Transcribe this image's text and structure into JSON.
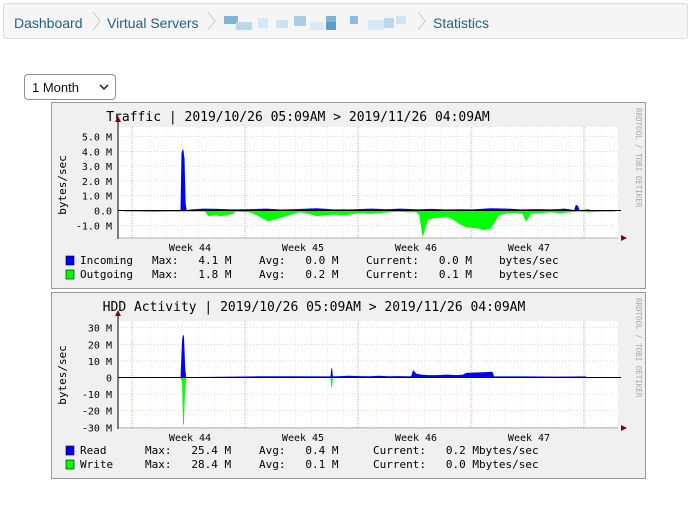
{
  "breadcrumb": {
    "dashboard": "Dashboard",
    "virtual_servers": "Virtual Servers",
    "statistics": "Statistics"
  },
  "period_select": {
    "value": "1 Month"
  },
  "graphs": {
    "traffic": {
      "title": "Traffic | 2019/10/26 05:09AM > 2019/11/26 04:09AM",
      "watermark": "RRDTOOL / TOBI OETIKER",
      "ylabel": "bytes/sec",
      "ticks": [
        "5.0 M",
        "4.0 M",
        "3.0 M",
        "2.0 M",
        "1.0 M",
        "0.0",
        "-1.0 M"
      ],
      "weeks": [
        "Week 44",
        "Week 45",
        "Week 46",
        "Week 47"
      ],
      "legend": [
        {
          "name": "Incoming",
          "color": "#0000ff",
          "max": "Max:   4.1 M",
          "avg": "Avg:   0.0 M",
          "current": "Current:   0.0 M",
          "unit": "bytes/sec"
        },
        {
          "name": "Outgoing",
          "color": "#00ff00",
          "max": "Max:   1.8 M",
          "avg": "Avg:   0.2 M",
          "current": "Current:   0.1 M",
          "unit": "bytes/sec"
        }
      ]
    },
    "hdd": {
      "title": "HDD Activity | 2019/10/26 05:09AM > 2019/11/26 04:09AM",
      "watermark": "RRDTOOL / TOBI OETIKER",
      "ylabel": "bytes/sec",
      "ticks": [
        "30 M",
        "20 M",
        "10 M",
        "0",
        "-10 M",
        "-20 M",
        "-30 M"
      ],
      "weeks": [
        "Week 44",
        "Week 45",
        "Week 46",
        "Week 47"
      ],
      "legend": [
        {
          "name": "Read",
          "color": "#0000ff",
          "max": "Max:   25.4 M",
          "avg": "Avg:   0.4 M",
          "current": "Current:   0.2 Mbytes/sec",
          "unit": ""
        },
        {
          "name": "Write",
          "color": "#00ff00",
          "max": "Max:   28.4 M",
          "avg": "Avg:   0.1 M",
          "current": "Current:   0.0 Mbytes/sec",
          "unit": ""
        }
      ]
    }
  },
  "chart_data": [
    {
      "type": "area",
      "title": "Traffic | 2019/10/26 05:09AM > 2019/11/26 04:09AM",
      "ylabel": "bytes/sec",
      "ylim": [
        -1.5,
        5.5
      ],
      "x_unit": "days since 2019/10/26 05:09AM",
      "xlim": [
        0,
        31
      ],
      "series": [
        {
          "name": "Incoming",
          "color": "#0000ff",
          "direction": "up",
          "x": [
            3.9,
            3.96,
            4.03,
            4.1,
            4.17,
            4.24,
            4.55,
            5.3,
            6.2,
            7.1,
            8.0,
            9.2,
            10.1,
            11.0,
            12.3,
            13.4,
            14.5,
            15.7,
            16.6,
            17.5,
            18.6,
            19.4,
            20.3,
            21.2,
            22.0,
            23.1,
            24.1,
            25.0,
            26.0,
            26.9,
            27.7,
            28.3,
            28.4,
            28.5,
            28.6,
            29.2
          ],
          "values": [
            0.0,
            3.9,
            4.1,
            3.5,
            0.4,
            0.0,
            0.05,
            0.1,
            0.08,
            0.05,
            0.06,
            0.1,
            0.04,
            0.07,
            0.12,
            0.05,
            0.05,
            0.1,
            0.06,
            0.1,
            0.05,
            0.08,
            0.05,
            0.06,
            0.05,
            0.12,
            0.1,
            0.05,
            0.07,
            0.05,
            0.1,
            0.0,
            0.35,
            0.3,
            0.0,
            0.05
          ]
        },
        {
          "name": "Outgoing",
          "color": "#00ff00",
          "direction": "down",
          "x": [
            0.4,
            1.2,
            2.1,
            3.0,
            3.8,
            4.2,
            4.6,
            5.4,
            5.6,
            6.0,
            6.4,
            6.8,
            7.1,
            7.3,
            7.7,
            8.2,
            8.8,
            9.3,
            10.0,
            10.6,
            11.2,
            11.7,
            12.3,
            12.9,
            13.4,
            14.1,
            14.6,
            15.2,
            15.7,
            16.2,
            16.8,
            17.4,
            18.0,
            18.5,
            18.7,
            18.9,
            19.2,
            19.6,
            20.0,
            20.4,
            20.8,
            21.2,
            21.6,
            22.0,
            22.4,
            22.7,
            23.1,
            23.6,
            24.2,
            24.7,
            25.1,
            25.3,
            25.6,
            26.2,
            26.8,
            27.4,
            28.0,
            28.6,
            29.2,
            30.0,
            30.8
          ],
          "values": [
            0.05,
            0.05,
            0.08,
            0.06,
            0.05,
            0.05,
            0.05,
            0.05,
            0.35,
            0.3,
            0.35,
            0.3,
            0.2,
            0.05,
            0.08,
            0.1,
            0.4,
            0.7,
            0.5,
            0.3,
            0.1,
            0.15,
            0.35,
            0.3,
            0.25,
            0.3,
            0.2,
            0.15,
            0.2,
            0.15,
            0.1,
            0.05,
            0.1,
            0.08,
            0.3,
            1.7,
            0.6,
            0.5,
            0.45,
            0.4,
            0.6,
            0.9,
            1.1,
            1.15,
            1.2,
            1.3,
            1.2,
            0.3,
            0.15,
            0.15,
            0.2,
            0.7,
            0.2,
            0.15,
            0.1,
            0.15,
            0.1,
            0.05,
            0.1,
            0.05,
            0.05
          ]
        }
      ]
    },
    {
      "type": "area",
      "title": "HDD Activity | 2019/10/26 05:09AM > 2019/11/26 04:09AM",
      "ylabel": "bytes/sec",
      "ylim": [
        -31,
        31
      ],
      "x_unit": "days since 2019/10/26 05:09AM",
      "xlim": [
        0,
        31
      ],
      "series": [
        {
          "name": "Read",
          "color": "#0000ff",
          "direction": "up",
          "x": [
            3.9,
            4.0,
            4.06,
            4.14,
            4.2,
            8.6,
            10.7,
            12.9,
            13.2,
            13.25,
            13.3,
            13.6,
            14.3,
            15.0,
            15.6,
            16.2,
            16.8,
            17.4,
            17.9,
            18.2,
            18.3,
            18.5,
            18.8,
            19.2,
            19.8,
            20.4,
            21.0,
            21.4,
            21.6,
            22.2,
            22.8,
            23.2,
            23.3,
            24.0,
            25.2,
            27.2,
            29.0
          ],
          "values": [
            0.0,
            23.0,
            25.4,
            6.0,
            0.0,
            0.5,
            0.5,
            0.4,
            0.5,
            5.5,
            0.5,
            0.5,
            0.8,
            0.6,
            0.5,
            0.8,
            0.5,
            0.6,
            0.5,
            0.6,
            4.0,
            2.0,
            1.5,
            1.2,
            1.2,
            1.5,
            1.2,
            1.5,
            2.5,
            2.8,
            3.0,
            3.2,
            0.5,
            0.4,
            0.4,
            0.3,
            0.4
          ]
        },
        {
          "name": "Write",
          "color": "#00ff00",
          "direction": "down",
          "x": [
            3.9,
            4.0,
            4.06,
            4.12,
            4.2,
            13.2,
            13.25,
            13.3
          ],
          "values": [
            0.0,
            3.0,
            28.4,
            10.0,
            0.0,
            0.0,
            6.0,
            0.0
          ]
        }
      ]
    }
  ]
}
